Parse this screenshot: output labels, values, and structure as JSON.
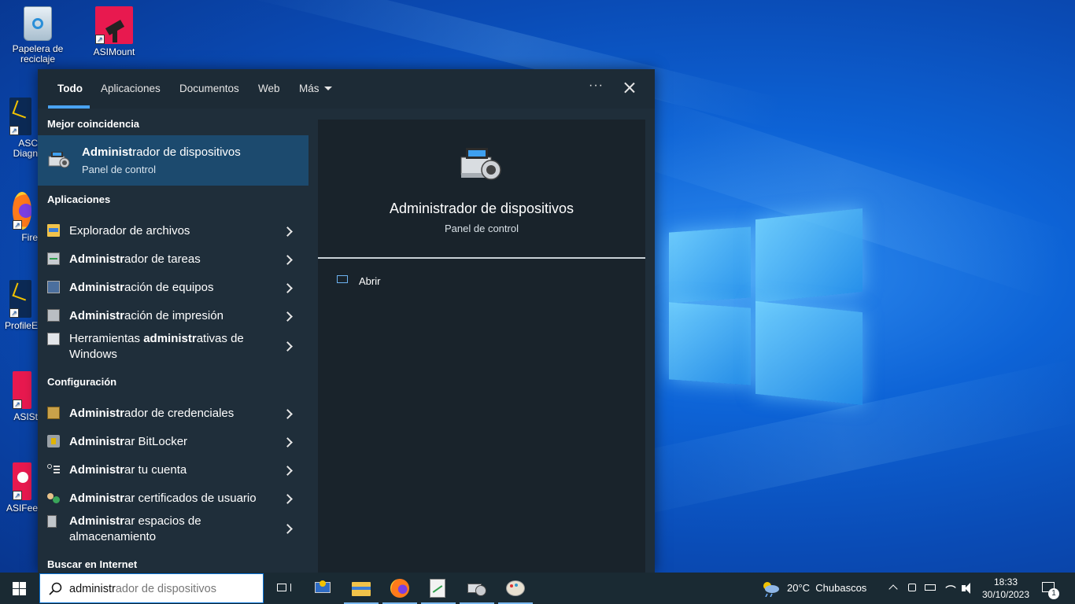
{
  "desktop": {
    "icons": [
      {
        "label": "Papelera de reciclaje",
        "icon": "recycle-bin-icon"
      },
      {
        "label": "ASIMount",
        "icon": "telescope-mount-icon"
      },
      {
        "label": "ASC Diagn",
        "icon": "asc-diagnostics-icon"
      },
      {
        "label": "Fire",
        "icon": "firefox-icon"
      },
      {
        "label": "ProfileE",
        "icon": "profile-editor-icon"
      },
      {
        "label": "ASISt",
        "icon": "asistudio-icon"
      },
      {
        "label": "ASIFee",
        "icon": "asi-feedback-icon"
      }
    ]
  },
  "search_panel": {
    "tabs": [
      {
        "label": "Todo",
        "active": true
      },
      {
        "label": "Aplicaciones"
      },
      {
        "label": "Documentos"
      },
      {
        "label": "Web"
      },
      {
        "label": "Más"
      }
    ],
    "more_icon": "ellipsis-icon",
    "close_icon": "close-icon",
    "best_match": {
      "section": "Mejor coincidencia",
      "title_bold": "Administ",
      "title_rest": "rador de dispositivos",
      "subtitle": "Panel de control"
    },
    "apps_section": "Aplicaciones",
    "apps": [
      {
        "pre": "",
        "bold": "",
        "rest": "Explorador de archivos",
        "icon": "file-explorer-icon"
      },
      {
        "pre": "",
        "bold": "Administr",
        "rest": "ador de tareas",
        "icon": "task-manager-icon"
      },
      {
        "pre": "",
        "bold": "Administr",
        "rest": "ación de equipos",
        "icon": "computer-management-icon"
      },
      {
        "pre": "",
        "bold": "Administr",
        "rest": "ación de impresión",
        "icon": "print-management-icon"
      },
      {
        "pre": "Herramientas ",
        "bold": "administr",
        "rest": "ativas de Windows",
        "icon": "admin-tools-icon"
      }
    ],
    "config_section": "Configuración",
    "config": [
      {
        "pre": "",
        "bold": "Administr",
        "rest": "ador de credenciales",
        "icon": "credential-manager-icon"
      },
      {
        "pre": "",
        "bold": "Administr",
        "rest": "ar BitLocker",
        "icon": "bitlocker-icon"
      },
      {
        "pre": "",
        "bold": "Administr",
        "rest": "ar tu cuenta",
        "icon": "account-icon"
      },
      {
        "pre": "",
        "bold": "Administr",
        "rest": "ar certificados de usuario",
        "icon": "certificate-icon"
      },
      {
        "pre": "",
        "bold": "Administr",
        "rest": "ar espacios de almacenamiento",
        "icon": "storage-spaces-icon"
      }
    ],
    "web_section": "Buscar en Internet",
    "preview": {
      "title": "Administrador de dispositivos",
      "subtitle": "Panel de control",
      "icon": "device-manager-icon",
      "action": "Abrir"
    }
  },
  "taskbar": {
    "search_typed": "administr",
    "search_rest": "ador de dispositivos",
    "weather": "20°C  Chubascos",
    "time": "18:33",
    "date": "30/10/2023",
    "notification_count": "1"
  }
}
